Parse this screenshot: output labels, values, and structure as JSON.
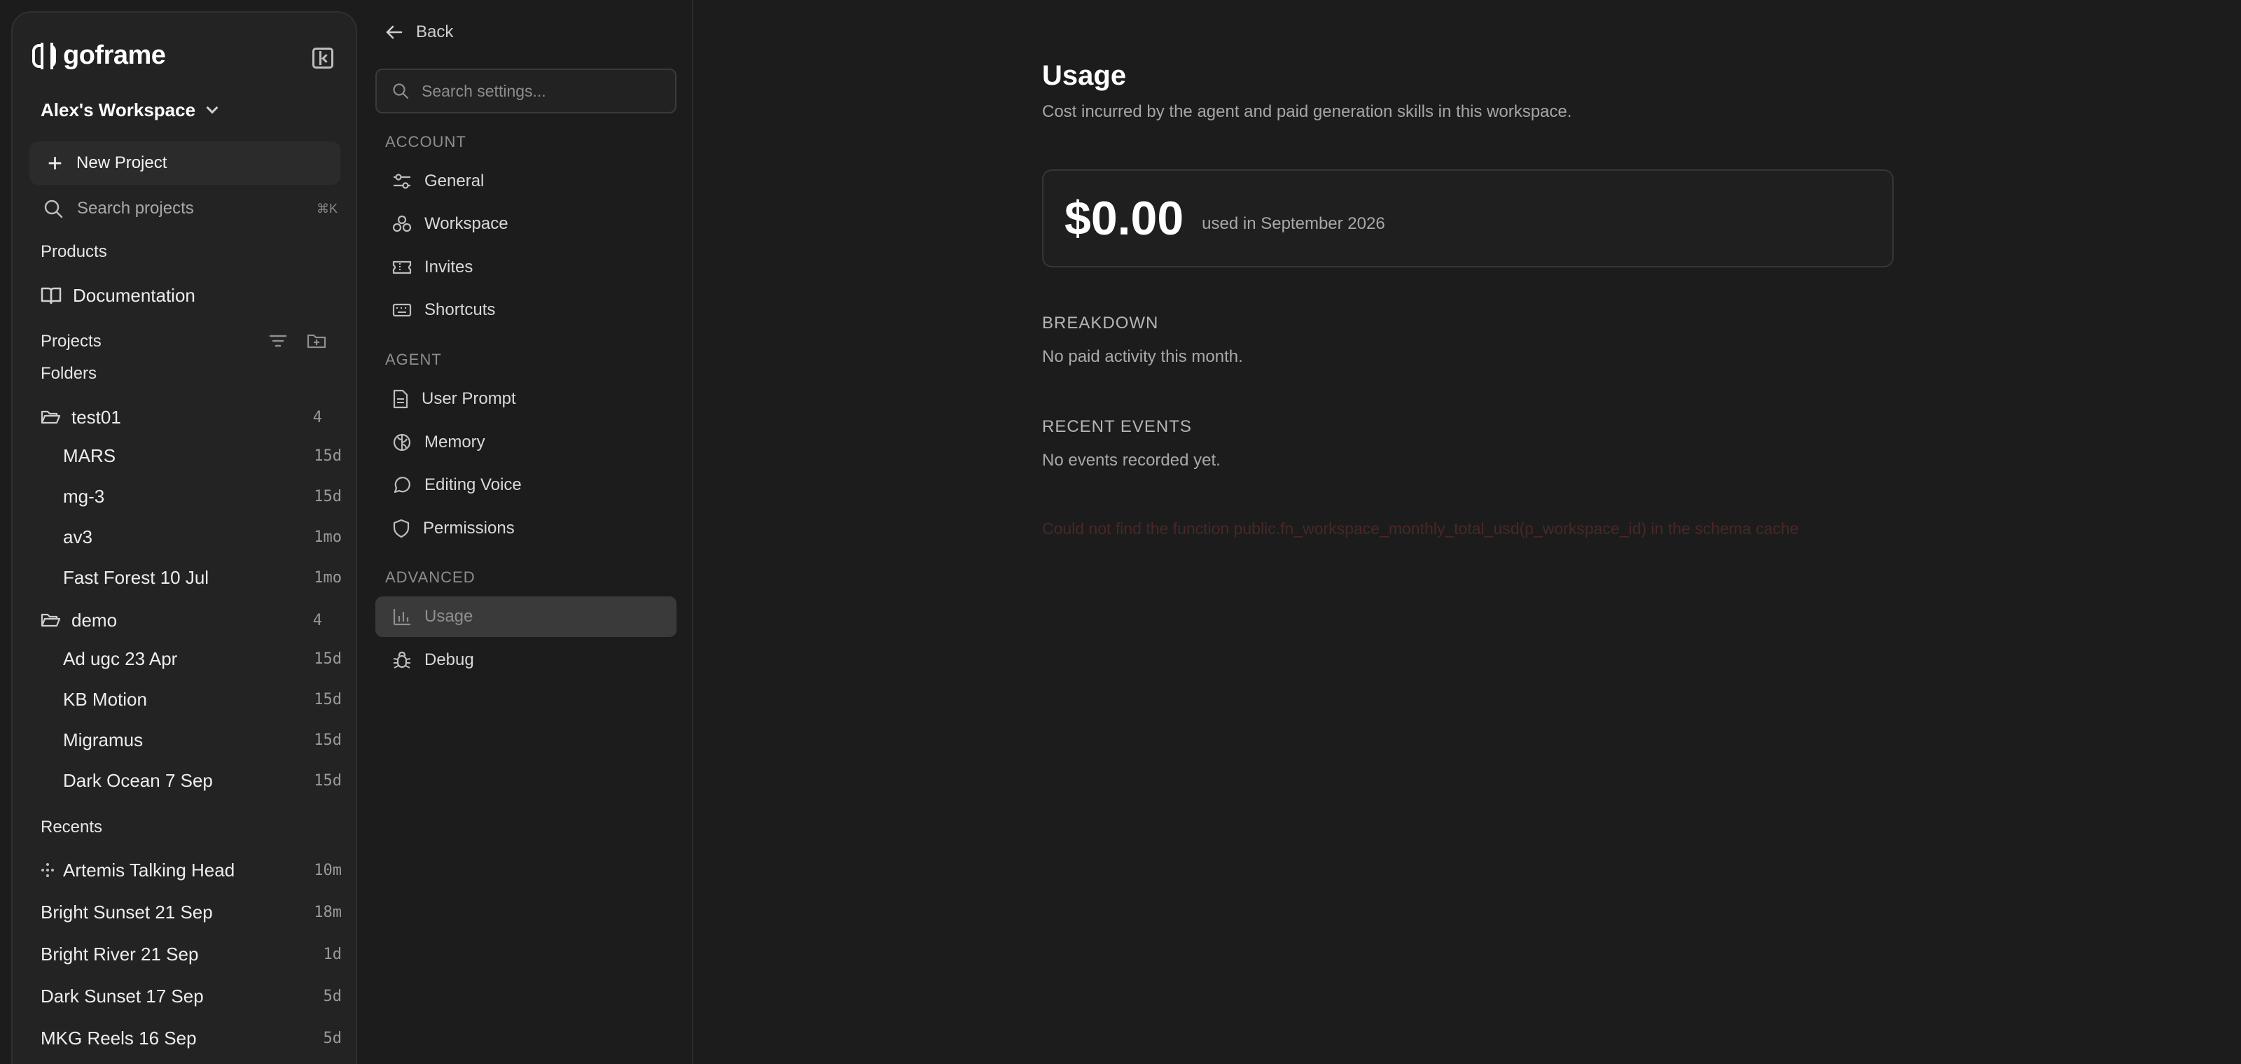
{
  "sidebar": {
    "brand": "goframe",
    "workspace": "Alex's Workspace",
    "new_project_label": "New Project",
    "search_placeholder": "Search projects",
    "search_shortcut": "⌘K",
    "products_label": "Products",
    "documentation_label": "Documentation",
    "projects_label": "Projects",
    "folders_label": "Folders",
    "folders": [
      {
        "name": "test01",
        "count": "4",
        "items": [
          {
            "name": "MARS",
            "age": "15d"
          },
          {
            "name": "mg-3",
            "age": "15d"
          },
          {
            "name": "av3",
            "age": "1mo"
          },
          {
            "name": "Fast Forest 10 Jul",
            "age": "1mo"
          }
        ]
      },
      {
        "name": "demo",
        "count": "4",
        "items": [
          {
            "name": "Ad ugc 23 Apr",
            "age": "15d"
          },
          {
            "name": "KB Motion",
            "age": "15d"
          },
          {
            "name": "Migramus",
            "age": "15d"
          },
          {
            "name": "Dark Ocean 7 Sep",
            "age": "15d"
          }
        ]
      }
    ],
    "recents_label": "Recents",
    "recents": [
      {
        "name": "Artemis Talking Head",
        "age": "10m"
      },
      {
        "name": "Bright Sunset 21 Sep",
        "age": "18m"
      },
      {
        "name": "Bright River 21 Sep",
        "age": "1d"
      },
      {
        "name": "Dark Sunset 17 Sep",
        "age": "5d"
      },
      {
        "name": "MKG Reels 16 Sep",
        "age": "5d"
      }
    ]
  },
  "settings_nav": {
    "back_label": "Back",
    "search_placeholder": "Search settings...",
    "groups": [
      {
        "label": "ACCOUNT",
        "items": [
          "General",
          "Workspace",
          "Invites",
          "Shortcuts"
        ]
      },
      {
        "label": "AGENT",
        "items": [
          "User Prompt",
          "Memory",
          "Editing Voice",
          "Permissions"
        ]
      },
      {
        "label": "ADVANCED",
        "items": [
          "Usage",
          "Debug"
        ]
      }
    ],
    "active_item": "Usage"
  },
  "main": {
    "title": "Usage",
    "subtitle": "Cost incurred by the agent and paid generation skills in this workspace.",
    "amount": "$0.00",
    "period": "used in September 2026",
    "breakdown_heading": "BREAKDOWN",
    "breakdown_empty": "No paid activity this month.",
    "events_heading": "RECENT EVENTS",
    "events_empty": "No events recorded yet.",
    "error_text": "Could not find the function public.fn_workspace_monthly_total_usd(p_workspace_id) in the schema cache"
  },
  "colors": {
    "background": "#1c1c1c",
    "sidebar_bg": "#232323",
    "active_nav": "#3a3a3a",
    "error_text": "#4a2727"
  }
}
